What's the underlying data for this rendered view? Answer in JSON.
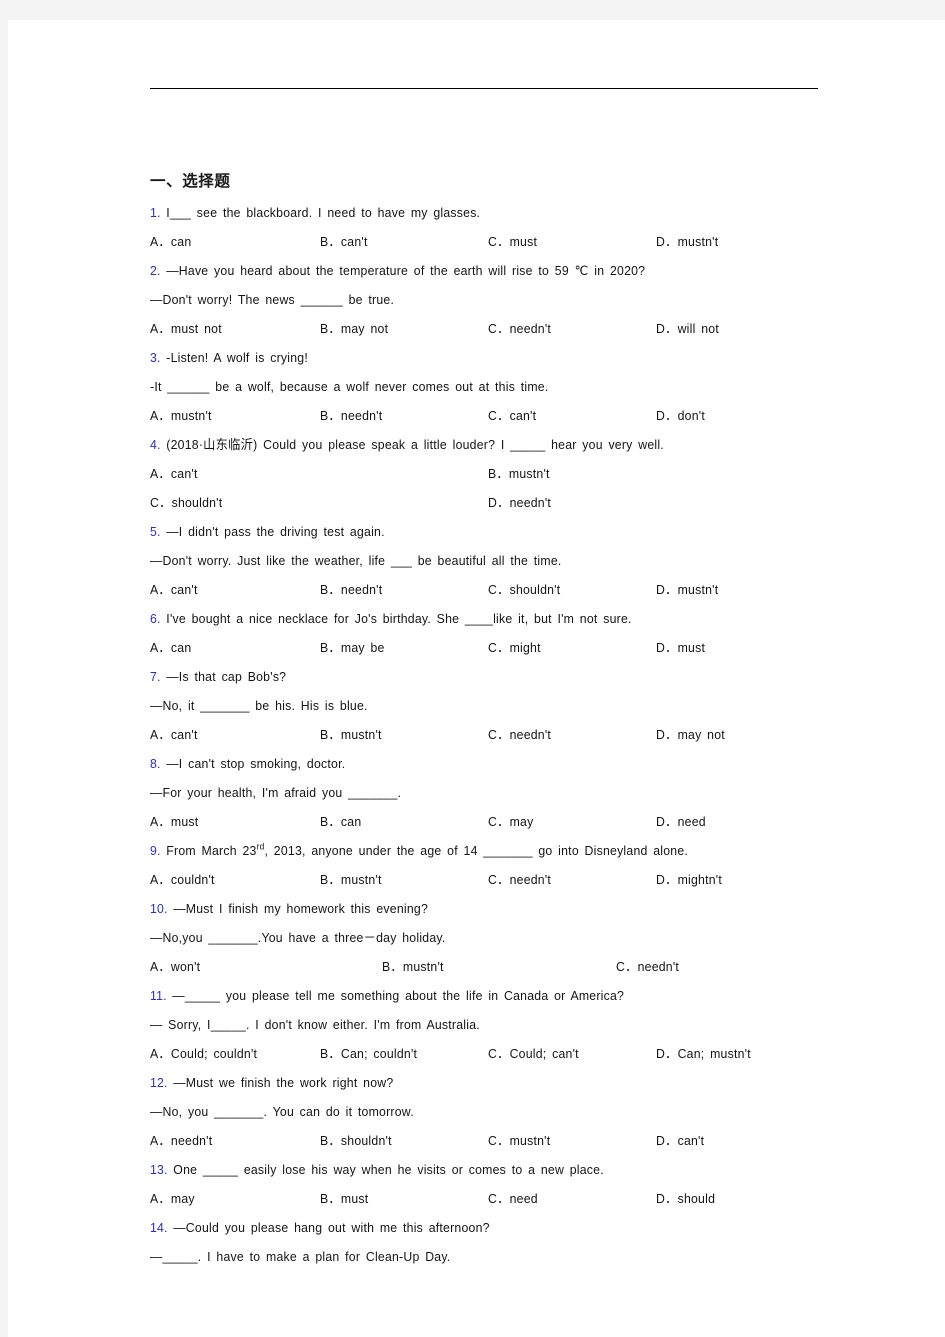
{
  "document": {
    "section_heading": "一、选择题"
  },
  "questions": [
    {
      "number": "1.",
      "lines": [
        "I___  see the blackboard. I need to have my glasses."
      ],
      "layout": "cols4",
      "options": [
        "A．can",
        "B．can't",
        "C．must",
        "D．mustn't"
      ]
    },
    {
      "number": "2.",
      "lines": [
        "—Have you heard about the temperature of the earth will rise to 59 ℃ in 2020?",
        "—Don't worry! The news ______ be true."
      ],
      "layout": "cols4",
      "options": [
        "A．must not",
        "B．may not",
        "C．needn't",
        "D．will not"
      ]
    },
    {
      "number": "3.",
      "lines": [
        "-Listen! A wolf is crying!",
        "-It ______ be a wolf, because a wolf never comes out at this time."
      ],
      "layout": "cols4",
      "options": [
        "A．mustn't",
        "B．needn't",
        "C．can't",
        "D．don't"
      ]
    },
    {
      "number": "4.",
      "lines": [
        "(2018·山东临沂) Could you please speak a little louder? I _____ hear you very well."
      ],
      "layout": "cols2",
      "options": [
        "A．can't",
        "B．mustn't",
        "C．shouldn't",
        "D．needn't"
      ]
    },
    {
      "number": "5.",
      "lines": [
        "—I didn't pass the driving test again.",
        "—Don't worry. Just like the weather, life ___   be beautiful all the time."
      ],
      "layout": "cols4",
      "options": [
        "A．can't",
        "B．needn't",
        "C．shouldn't",
        "D．mustn't"
      ]
    },
    {
      "number": "6.",
      "lines": [
        "I've bought a nice necklace for Jo's birthday. She ____like it, but I'm not sure."
      ],
      "layout": "cols4",
      "options": [
        "A．can",
        "B．may be",
        "C．might",
        "D．must"
      ]
    },
    {
      "number": "7.",
      "lines": [
        "—Is that cap Bob's?",
        "—No, it _______ be his. His is blue."
      ],
      "layout": "cols4",
      "options": [
        "A．can't",
        "B．mustn't",
        "C．needn't",
        "D．may not"
      ]
    },
    {
      "number": "8.",
      "lines": [
        "—I can't stop smoking, doctor.",
        "—For your health, I'm afraid you _______."
      ],
      "layout": "cols4",
      "options": [
        "A．must",
        "B．can",
        "C．may",
        "D．need"
      ]
    },
    {
      "number": "9.",
      "lines_html": [
        "From March 23<sup>rd</sup>, 2013, anyone under the age of 14 _______ go into Disneyland alone."
      ],
      "layout": "cols4",
      "options": [
        "A．couldn't",
        "B．mustn't",
        "C．needn't",
        "D．mightn't"
      ]
    },
    {
      "number": "10.",
      "lines": [
        "—Must I finish my homework this evening?",
        "—No,you _______.You have a three－day holiday."
      ],
      "layout": "cols3",
      "options": [
        "A．won't",
        "B．mustn't",
        "C．needn't"
      ]
    },
    {
      "number": "11.",
      "lines": [
        "—_____ you please tell me something about the life in Canada or America?",
        "— Sorry, I_____. I don't know either. I'm from Australia."
      ],
      "layout": "cols4",
      "options": [
        "A．Could; couldn't",
        "B．Can; couldn't",
        "C．Could; can't",
        "D．Can; mustn't"
      ]
    },
    {
      "number": "12.",
      "lines": [
        "—Must we finish the work right now?",
        "—No, you _______. You can do it tomorrow."
      ],
      "layout": "cols4",
      "options": [
        "A．needn't",
        "B．shouldn't",
        "C．mustn't",
        "D．can't"
      ]
    },
    {
      "number": "13.",
      "lines": [
        "One _____ easily lose his way when he visits or comes to a new place."
      ],
      "layout": "cols4",
      "options": [
        "A．may",
        "B．must",
        "C．need",
        "D．should"
      ]
    },
    {
      "number": "14.",
      "lines": [
        "—Could you please hang out with me this afternoon?",
        "—_____. I have to make a plan for Clean-Up Day."
      ],
      "layout": "none",
      "options": []
    }
  ]
}
